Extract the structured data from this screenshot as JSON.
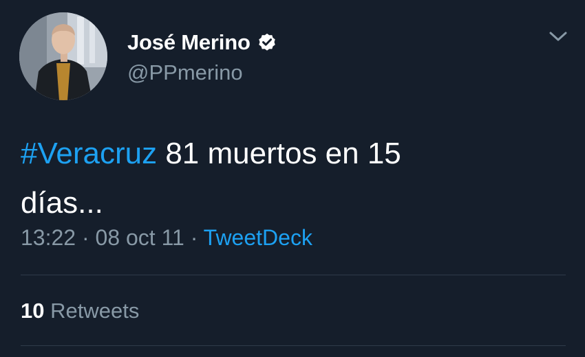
{
  "user": {
    "display_name": "José Merino",
    "handle": "@PPmerino",
    "verified_icon": "verified-badge-icon",
    "avatar_icon": "profile-photo"
  },
  "tweet": {
    "hashtag": "#Veracruz",
    "text_line1_rest": " 81 muertos en 15",
    "text_line2": "días..."
  },
  "meta": {
    "time": "13:22",
    "sep1": " · ",
    "date": "08 oct 11",
    "sep2": " · ",
    "source": "TweetDeck"
  },
  "stats": {
    "retweets_count": "10",
    "retweets_label": " Retweets"
  },
  "colors": {
    "background": "#151e2b",
    "accent": "#1da1f2",
    "secondary_text": "#8899a6",
    "divider": "#2f3b4a"
  },
  "menu": {
    "icon": "chevron-down-icon"
  }
}
